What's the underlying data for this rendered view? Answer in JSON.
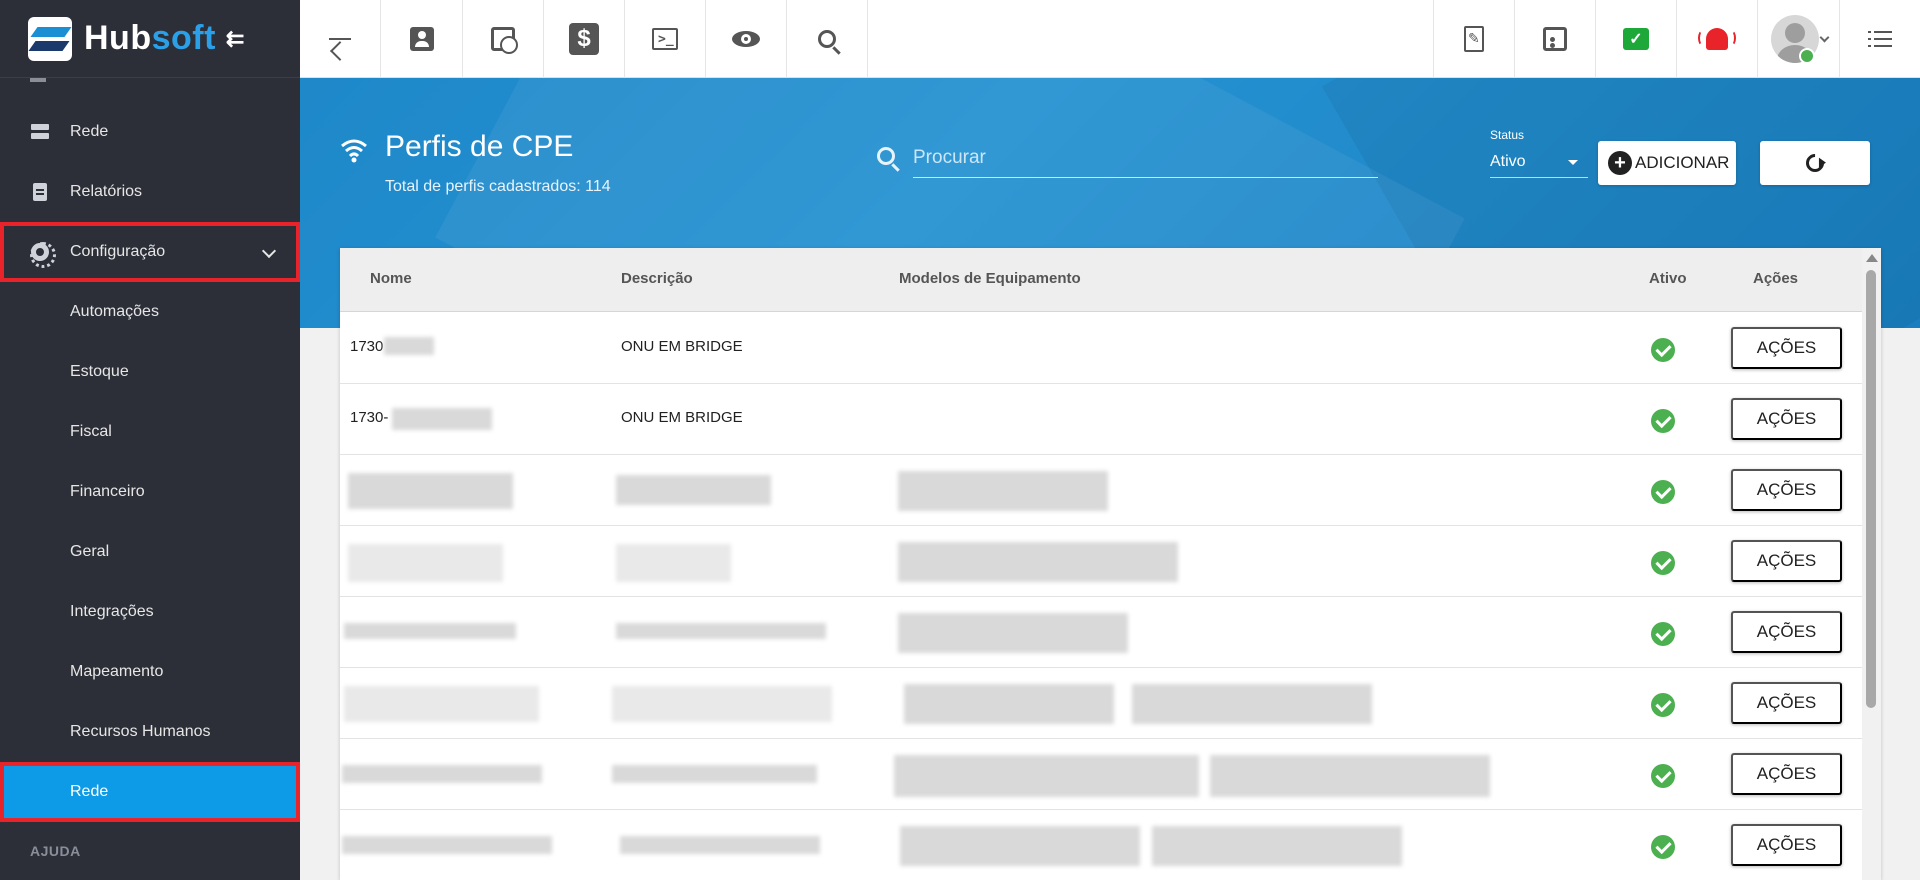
{
  "app": {
    "logo_part1": "Hub",
    "logo_part2": "soft",
    "collapse_icon": "arrow-collapse-left-icon"
  },
  "sidebar": {
    "items": [
      {
        "label": "Rede",
        "icon": "server-icon"
      },
      {
        "label": "Relatórios",
        "icon": "document-icon"
      },
      {
        "label": "Configuração",
        "icon": "gear-icon"
      }
    ],
    "sub_items": [
      "Automações",
      "Estoque",
      "Fiscal",
      "Financeiro",
      "Geral",
      "Integrações",
      "Mapeamento",
      "Recursos Humanos",
      "Rede"
    ],
    "section_label": "AJUDA",
    "colors": {
      "background": "#2c2f38",
      "active": "#0d9be8",
      "highlight": "#e8232a"
    }
  },
  "topbar": {
    "left_icons": [
      "back-arrow-icon",
      "contact-icon",
      "calendar-clock-icon",
      "dollar-icon",
      "terminal-icon",
      "eye-icon",
      "search-icon"
    ],
    "right_icons": [
      "pdf-icon",
      "badge-icon",
      "chat-check-icon",
      "alarm-bell-icon",
      "user-avatar",
      "menu-list-icon"
    ],
    "dollar_glyph": "$",
    "chat_glyph": "✓",
    "terminal_glyph": ">_",
    "colors": {
      "chat": "#1fa83a",
      "bell": "#e8232a"
    }
  },
  "header": {
    "title": "Perfis de CPE",
    "subtitle": "Total de perfis cadastrados: 114",
    "search_placeholder": "Procurar",
    "status_label": "Status",
    "status_value": "Ativo",
    "add_label": "ADICIONAR",
    "add_glyph": "+",
    "colors": {
      "band": "#1e88c9"
    }
  },
  "table": {
    "columns": [
      "Nome",
      "Descrição",
      "Modelos de Equipamento",
      "Ativo",
      "Ações"
    ],
    "action_label": "AÇÕES",
    "rows": [
      {
        "nome": "1730",
        "descricao": "ONU EM BRIDGE",
        "ativo": true
      },
      {
        "nome": "1730-",
        "descricao": "ONU EM BRIDGE",
        "ativo": true
      },
      {
        "nome": "",
        "descricao": "",
        "ativo": true
      },
      {
        "nome": "",
        "descricao": "",
        "ativo": true
      },
      {
        "nome": "",
        "descricao": "",
        "ativo": true
      },
      {
        "nome": "",
        "descricao": "",
        "ativo": true
      },
      {
        "nome": "",
        "descricao": "",
        "ativo": true
      },
      {
        "nome": "",
        "descricao": "",
        "ativo": true
      }
    ],
    "colors": {
      "check": "#4caf50"
    }
  }
}
